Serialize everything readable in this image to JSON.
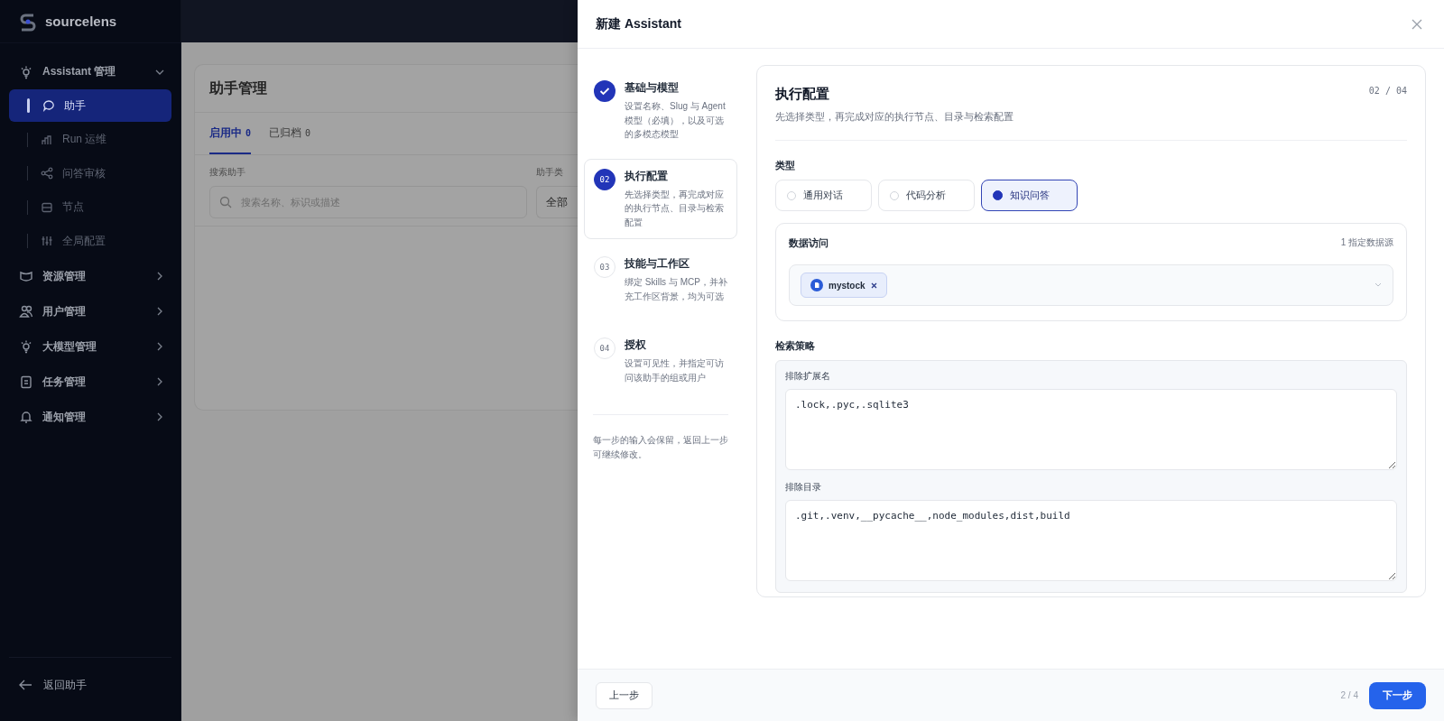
{
  "sidebar": {
    "brand": "sourcelens",
    "groups": [
      {
        "label": "Assistant 管理",
        "expanded": true,
        "children": [
          {
            "label": "助手",
            "selected": true
          },
          {
            "label": "Run 运维",
            "selected": false
          },
          {
            "label": "问答审核",
            "selected": false
          },
          {
            "label": "节点",
            "selected": false
          },
          {
            "label": "全局配置",
            "selected": false
          }
        ]
      },
      {
        "label": "资源管理",
        "expanded": false
      },
      {
        "label": "用户管理",
        "expanded": false
      },
      {
        "label": "大模型管理",
        "expanded": false
      },
      {
        "label": "任务管理",
        "expanded": false
      },
      {
        "label": "通知管理",
        "expanded": false
      }
    ],
    "back_link": "返回助手"
  },
  "background_page": {
    "title": "助手管理",
    "tabs": [
      {
        "label": "启用中",
        "count": "0",
        "selected": true
      },
      {
        "label": "已归档",
        "count": "0",
        "selected": false
      }
    ],
    "search_label": "搜索助手",
    "search": {
      "placeholder": "搜索名称、标识或描述"
    },
    "type_filter_label": "助手类",
    "type_filter_value": "全部"
  },
  "drawer": {
    "title": "新建 Assistant",
    "steps": [
      {
        "title": "基础与模型",
        "description": "设置名称、Slug 与 Agent 模型（必填），以及可选的多模态模型",
        "completed": true,
        "selected": false
      },
      {
        "number": "02",
        "title": "执行配置",
        "description": "先选择类型，再完成对应的执行节点、目录与检索配置",
        "completed": false,
        "selected": true
      },
      {
        "number": "03",
        "title": "技能与工作区",
        "description": "绑定 Skills 与 MCP，并补充工作区背景，均为可选",
        "completed": false,
        "selected": false
      },
      {
        "number": "04",
        "title": "授权",
        "description": "设置可见性，并指定可访问该助手的组或用户",
        "completed": false,
        "selected": false
      }
    ],
    "note": "每一步的输入会保留，返回上一步可继续修改。",
    "panel": {
      "title": "执行配置",
      "subtitle": "先选择类型，再完成对应的执行节点、目录与检索配置",
      "progress": "02 / 04",
      "type_label": "类型",
      "type_options": [
        {
          "label": "通用对话",
          "selected": false
        },
        {
          "label": "代码分析",
          "selected": false
        },
        {
          "label": "知识问答",
          "selected": true
        }
      ],
      "data_access": {
        "title": "数据访问",
        "count": "1 指定数据源",
        "tags": [
          {
            "label": "mystock"
          }
        ]
      },
      "retrieval_label": "检索策略",
      "fields": [
        {
          "label": "排除扩展名",
          "value": ".lock,.pyc,.sqlite3"
        },
        {
          "label": "排除目录",
          "value": ".git,.venv,__pycache__,node_modules,dist,build"
        }
      ]
    },
    "footer": {
      "prev": "上一步",
      "page": "2 / 4",
      "next": "下一步"
    }
  }
}
